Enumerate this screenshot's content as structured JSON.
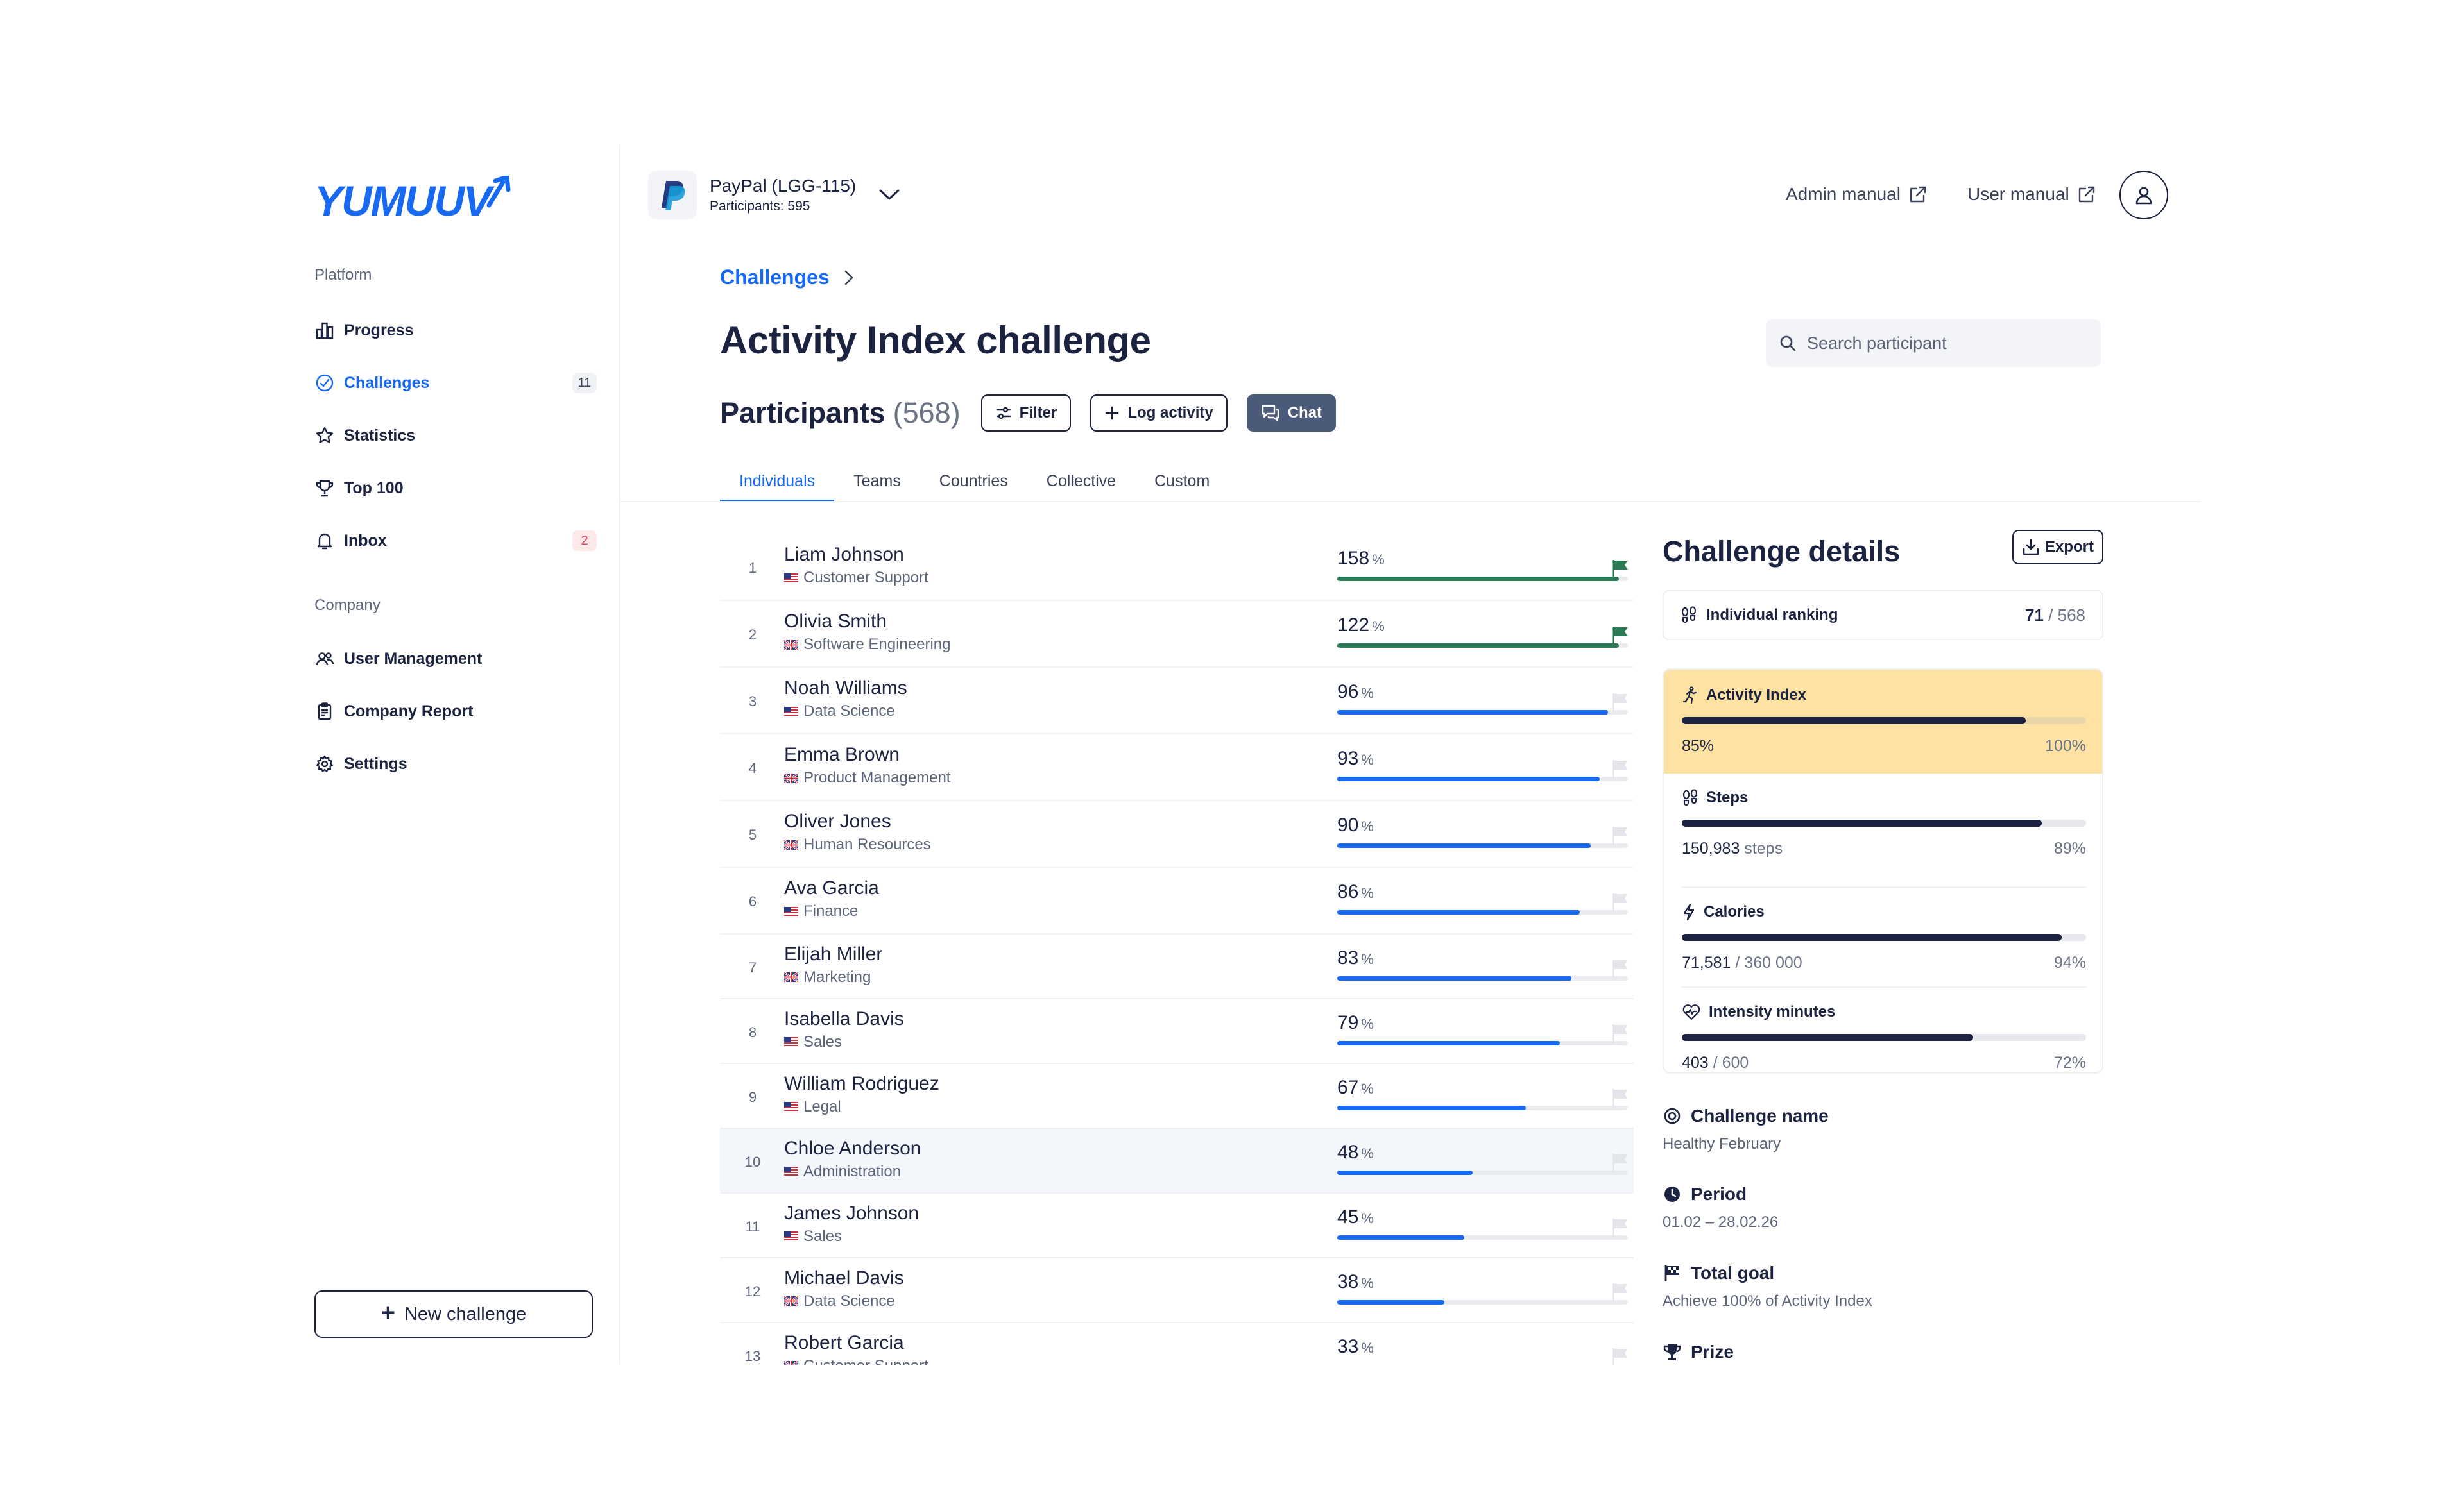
{
  "brand": {
    "logo_text": "YUMUUV",
    "accent": "#1669f0",
    "navy": "#1c2340"
  },
  "sidebar": {
    "platform_label": "Platform",
    "company_label": "Company",
    "items": [
      {
        "label": "Progress",
        "icon": "bar-chart-icon"
      },
      {
        "label": "Challenges",
        "icon": "challenges-icon",
        "badge": "11",
        "active": true
      },
      {
        "label": "Statistics",
        "icon": "star-icon"
      },
      {
        "label": "Top 100",
        "icon": "trophy-icon"
      },
      {
        "label": "Inbox",
        "icon": "bell-icon",
        "badge": "2"
      }
    ],
    "company_items": [
      {
        "label": "User Management",
        "icon": "users-icon"
      },
      {
        "label": "Company Report",
        "icon": "clipboard-icon"
      },
      {
        "label": "Settings",
        "icon": "gear-icon"
      }
    ],
    "new_challenge": "New challenge"
  },
  "topbar": {
    "company_name": "PayPal",
    "company_code": "(LGG-115)",
    "participants": "Participants: 595",
    "admin_manual": "Admin manual",
    "user_manual": "User manual"
  },
  "header": {
    "breadcrumb": "Challenges",
    "title": "Activity Index challenge",
    "search_placeholder": "Search participant",
    "participants_title": "Participants",
    "participants_count": "(568)",
    "filter": "Filter",
    "log_activity": "Log activity",
    "chat": "Chat",
    "tabs": [
      "Individuals",
      "Teams",
      "Countries",
      "Collective",
      "Custom"
    ]
  },
  "participants": [
    {
      "rank": "1",
      "name": "Liam Johnson",
      "dept": "Customer Support",
      "country": "us",
      "percent": 158,
      "done": true
    },
    {
      "rank": "2",
      "name": "Olivia Smith",
      "dept": "Software Engineering",
      "country": "uk",
      "percent": 122,
      "done": true
    },
    {
      "rank": "3",
      "name": "Noah Williams",
      "dept": "Data Science",
      "country": "us",
      "percent": 96
    },
    {
      "rank": "4",
      "name": "Emma Brown",
      "dept": "Product Management",
      "country": "uk",
      "percent": 93
    },
    {
      "rank": "5",
      "name": "Oliver Jones",
      "dept": "Human Resources",
      "country": "uk",
      "percent": 90
    },
    {
      "rank": "6",
      "name": "Ava Garcia",
      "dept": "Finance",
      "country": "us",
      "percent": 86
    },
    {
      "rank": "7",
      "name": "Elijah Miller",
      "dept": "Marketing",
      "country": "uk",
      "percent": 83
    },
    {
      "rank": "8",
      "name": "Isabella Davis",
      "dept": "Sales",
      "country": "us",
      "percent": 79
    },
    {
      "rank": "9",
      "name": "William Rodriguez",
      "dept": "Legal",
      "country": "us",
      "percent": 67
    },
    {
      "rank": "10",
      "name": "Chloe Anderson",
      "dept": "Administration",
      "country": "us",
      "percent": 48,
      "highlighted": true
    },
    {
      "rank": "11",
      "name": "James Johnson",
      "dept": "Sales",
      "country": "us",
      "percent": 45
    },
    {
      "rank": "12",
      "name": "Michael Davis",
      "dept": "Data Science",
      "country": "uk",
      "percent": 38
    },
    {
      "rank": "13",
      "name": "Robert Garcia",
      "dept": "Customer Support",
      "country": "uk",
      "percent": 33
    }
  ],
  "details": {
    "title": "Challenge details",
    "export": "Export",
    "ranking_label": "Individual ranking",
    "ranking_value": "71",
    "ranking_total": "/ 568",
    "activity": {
      "label": "Activity Index",
      "value": "85%",
      "target": "100%",
      "progress": 0.85,
      "color": "#fde2a3"
    },
    "metrics": [
      {
        "label": "Steps",
        "icon": "footprints-icon",
        "value": "150,983",
        "unit": "steps",
        "percent": "89%",
        "progress": 0.89
      },
      {
        "label": "Calories",
        "icon": "flash-icon",
        "value": "71,581",
        "unit": "/ 360 000",
        "percent": "94%",
        "progress": 0.94
      },
      {
        "label": "Intensity minutes",
        "icon": "heart-pulse-icon",
        "value": "403",
        "unit": "/ 600",
        "percent": "72%",
        "progress": 0.72
      }
    ],
    "info": [
      {
        "label": "Challenge name",
        "value": "Healthy February",
        "icon": "target-icon"
      },
      {
        "label": "Period",
        "value": "01.02 – 28.02.26",
        "icon": "clock-icon"
      },
      {
        "label": "Total goal",
        "value": "Achieve 100% of Activity Index",
        "icon": "finish-flag-icon"
      },
      {
        "label": "Prize",
        "value": "",
        "icon": "trophy-icon"
      }
    ]
  }
}
